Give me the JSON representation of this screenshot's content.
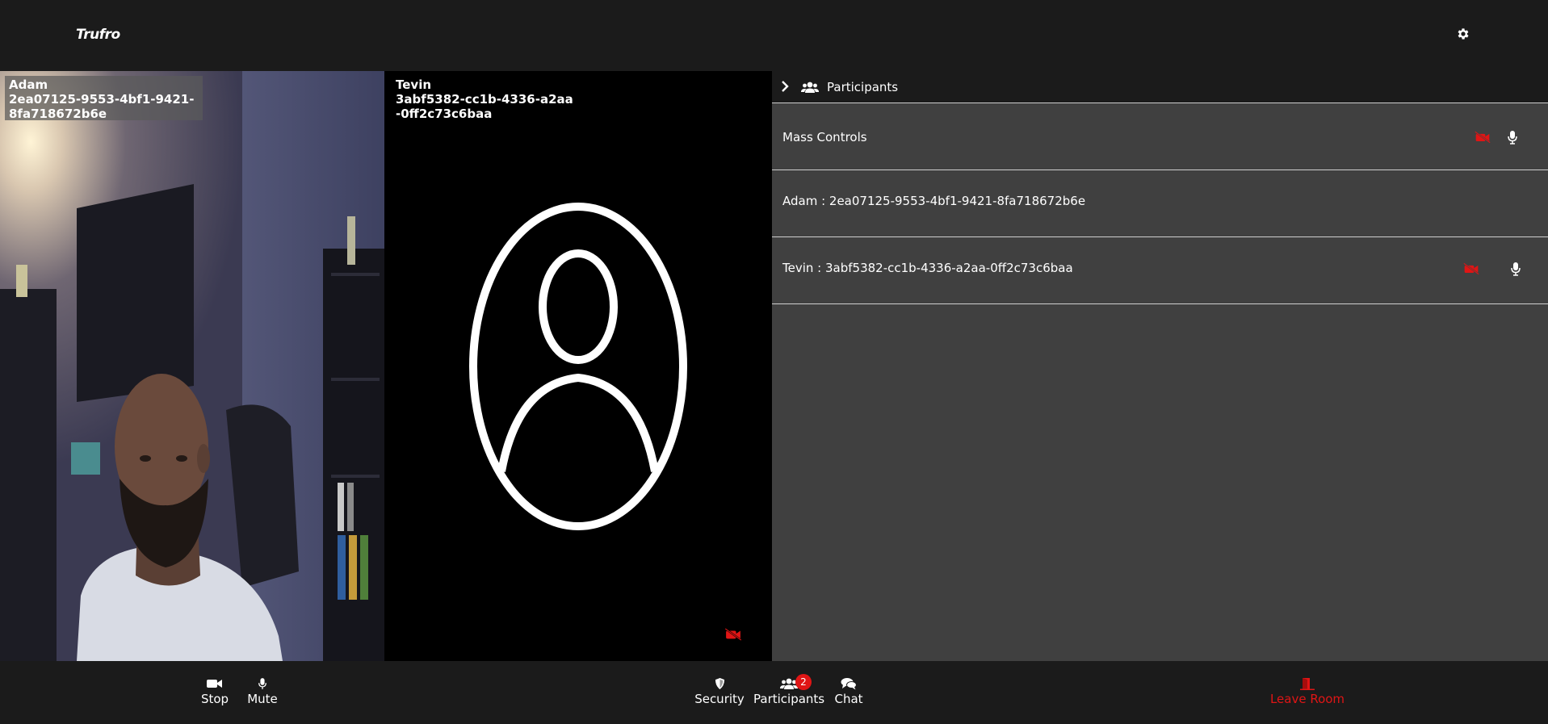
{
  "header": {
    "brand": "Trufro",
    "settings_icon": "gear-icon"
  },
  "tiles": {
    "adam": {
      "name": "Adam",
      "id": "2ea07125-9553-4bf1-9421-8fa718672b6e"
    },
    "tevin": {
      "name": "Tevin",
      "id": "3abf5382-cc1b-4336-a2aa-0ff2c73c6baa",
      "camera_icon": "camera-off-icon"
    }
  },
  "panel": {
    "title": "Participants",
    "rows": [
      {
        "label": "Mass Controls"
      },
      {
        "label": "Adam : 2ea07125-9553-4bf1-9421-8fa718672b6e"
      },
      {
        "label": "Tevin : 3abf5382-cc1b-4336-a2aa-0ff2c73c6baa"
      }
    ]
  },
  "toolbar": {
    "stop_label": "Stop",
    "mute_label": "Mute",
    "security_label": "Security",
    "participants_label": "Participants",
    "participants_count": "2",
    "chat_label": "Chat",
    "leave_label": "Leave Room"
  },
  "colors": {
    "accent_red": "#e01515",
    "panel_bg": "#404040",
    "bar_bg": "#1b1b1b"
  }
}
